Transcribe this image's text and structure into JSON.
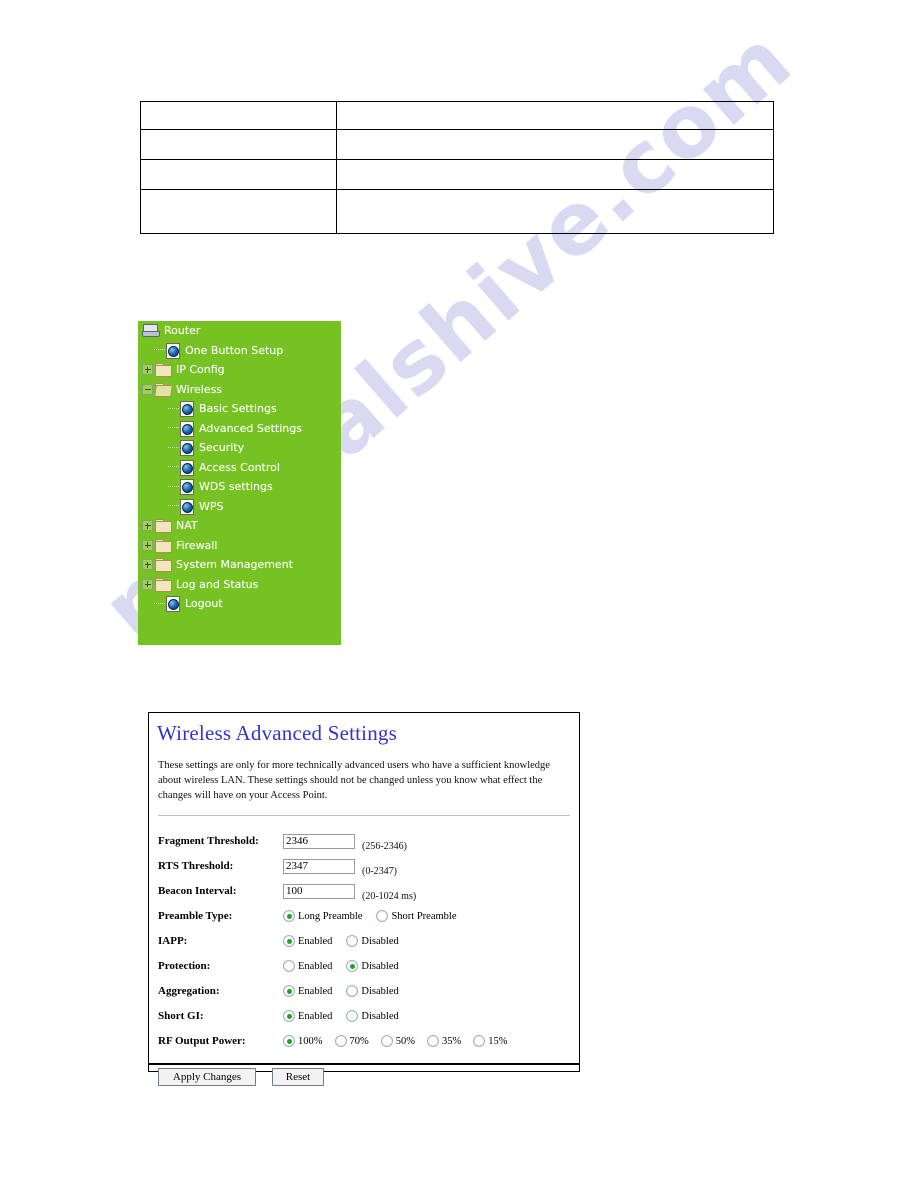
{
  "watermark": {
    "text": "manualshive.com",
    "color": "#d9d9f2"
  },
  "spec_table": {
    "rows": [
      {
        "label": "",
        "value": ""
      },
      {
        "label": "",
        "value": ""
      },
      {
        "label": "",
        "value": ""
      },
      {
        "label": "",
        "value": ""
      }
    ]
  },
  "tree_menu": {
    "background": "#76c223",
    "root": {
      "label": "Router",
      "icon": "router-icon"
    },
    "items": [
      {
        "label": "One Button Setup",
        "icon": "page-globe-icon",
        "level": 1,
        "expander": "none"
      },
      {
        "label": "IP Config",
        "icon": "folder-closed-icon",
        "level": 0,
        "expander": "plus"
      },
      {
        "label": "Wireless",
        "icon": "folder-open-icon",
        "level": 0,
        "expander": "minus"
      },
      {
        "label": "Basic Settings",
        "icon": "page-globe-icon",
        "level": 2,
        "expander": "none"
      },
      {
        "label": "Advanced Settings",
        "icon": "page-globe-icon",
        "level": 2,
        "expander": "none"
      },
      {
        "label": "Security",
        "icon": "page-globe-icon",
        "level": 2,
        "expander": "none"
      },
      {
        "label": "Access Control",
        "icon": "page-globe-icon",
        "level": 2,
        "expander": "none"
      },
      {
        "label": "WDS settings",
        "icon": "page-globe-icon",
        "level": 2,
        "expander": "none"
      },
      {
        "label": "WPS",
        "icon": "page-globe-icon",
        "level": 2,
        "expander": "none"
      },
      {
        "label": "NAT",
        "icon": "folder-closed-icon",
        "level": 0,
        "expander": "plus"
      },
      {
        "label": "Firewall",
        "icon": "folder-closed-icon",
        "level": 0,
        "expander": "plus"
      },
      {
        "label": "System Management",
        "icon": "folder-closed-icon",
        "level": 0,
        "expander": "plus"
      },
      {
        "label": "Log and Status",
        "icon": "folder-closed-icon",
        "level": 0,
        "expander": "plus"
      },
      {
        "label": "Logout",
        "icon": "page-globe-icon",
        "level": 1,
        "expander": "none"
      }
    ]
  },
  "settings_panel": {
    "title": "Wireless Advanced Settings",
    "title_color": "#3333cc",
    "description": "These settings are only for more technically advanced users who have a sufficient knowledge about wireless LAN. These settings should not be changed unless you know what effect the changes will have on your Access Point.",
    "fields": {
      "fragment_threshold": {
        "label": "Fragment Threshold:",
        "value": "2346",
        "range": "(256-2346)"
      },
      "rts_threshold": {
        "label": "RTS Threshold:",
        "value": "2347",
        "range": "(0-2347)"
      },
      "beacon_interval": {
        "label": "Beacon Interval:",
        "value": "100",
        "range": "(20-1024 ms)"
      }
    },
    "radio_rows": [
      {
        "label": "Preamble Type:",
        "options": [
          {
            "label": "Long Preamble",
            "selected": true
          },
          {
            "label": "Short Preamble",
            "selected": false
          }
        ]
      },
      {
        "label": "IAPP:",
        "options": [
          {
            "label": "Enabled",
            "selected": true
          },
          {
            "label": "Disabled",
            "selected": false
          }
        ]
      },
      {
        "label": "Protection:",
        "options": [
          {
            "label": "Enabled",
            "selected": false
          },
          {
            "label": "Disabled",
            "selected": true
          }
        ]
      },
      {
        "label": "Aggregation:",
        "options": [
          {
            "label": "Enabled",
            "selected": true
          },
          {
            "label": "Disabled",
            "selected": false
          }
        ]
      },
      {
        "label": "Short GI:",
        "options": [
          {
            "label": "Enabled",
            "selected": true
          },
          {
            "label": "Disabled",
            "selected": false
          }
        ]
      }
    ],
    "rf_output_power": {
      "label": "RF Output Power:",
      "options": [
        {
          "label": "100%",
          "selected": true
        },
        {
          "label": "70%",
          "selected": false
        },
        {
          "label": "50%",
          "selected": false
        },
        {
          "label": "35%",
          "selected": false
        },
        {
          "label": "15%",
          "selected": false
        }
      ]
    },
    "buttons": {
      "apply": "Apply Changes",
      "reset": "Reset"
    }
  }
}
